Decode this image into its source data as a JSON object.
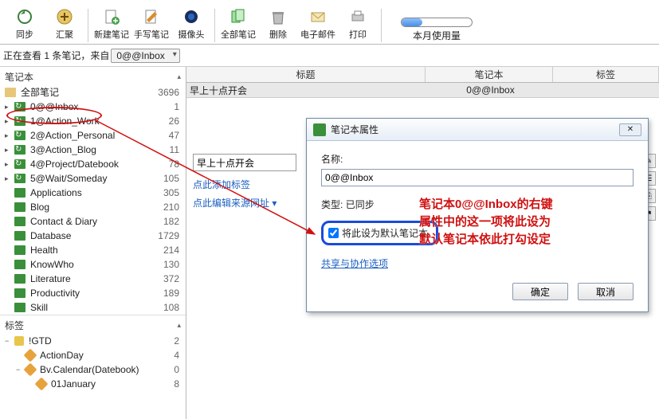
{
  "toolbar": {
    "sync": "同步",
    "aggregate": "汇聚",
    "new_note": "新建笔记",
    "handwrite": "手写笔记",
    "camera": "摄像头",
    "all_notes": "全部笔记",
    "delete": "删除",
    "email": "电子邮件",
    "print": "打印",
    "usage_label": "本月使用量"
  },
  "statusbar": {
    "prefix": "正在查看 1 条笔记，来自",
    "notebook": "0@@Inbox"
  },
  "sidebar": {
    "section_notebooks": "笔记本",
    "section_tags": "标签",
    "all_notes": {
      "label": "全部笔记",
      "count": "3696"
    },
    "notebooks": [
      {
        "label": "0@@Inbox",
        "count": "1",
        "highlighted": true
      },
      {
        "label": "1@Action_Work",
        "count": "26"
      },
      {
        "label": "2@Action_Personal",
        "count": "47"
      },
      {
        "label": "3@Action_Blog",
        "count": "11"
      },
      {
        "label": "4@Project/Datebook",
        "count": "78"
      },
      {
        "label": "5@Wait/Someday",
        "count": "105"
      },
      {
        "label": "Applications",
        "count": "305"
      },
      {
        "label": "Blog",
        "count": "210"
      },
      {
        "label": "Contact & Diary",
        "count": "182"
      },
      {
        "label": "Database",
        "count": "1729"
      },
      {
        "label": "Health",
        "count": "214"
      },
      {
        "label": "KnowWho",
        "count": "130"
      },
      {
        "label": "Literature",
        "count": "372"
      },
      {
        "label": "Productivity",
        "count": "189"
      },
      {
        "label": "Skill",
        "count": "108"
      }
    ],
    "tags": [
      {
        "label": "!GTD",
        "count": "2",
        "exp": "−",
        "indent": 0,
        "icon": "root"
      },
      {
        "label": "ActionDay",
        "count": "4",
        "exp": "",
        "indent": 1,
        "icon": "tag"
      },
      {
        "label": "Bv.Calendar(Datebook)",
        "count": "0",
        "exp": "−",
        "indent": 1,
        "icon": "tag"
      },
      {
        "label": "01January",
        "count": "8",
        "exp": "",
        "indent": 2,
        "icon": "tag"
      }
    ]
  },
  "list": {
    "headers": {
      "title": "标题",
      "notebook": "笔记本",
      "tags": "标签"
    },
    "row": {
      "title": "早上十点开会",
      "notebook": "0@@Inbox",
      "tags": ""
    }
  },
  "note": {
    "title_value": "早上十点开会",
    "add_tag": "点此添加标签",
    "edit_source": "点此编辑来源网址"
  },
  "dialog": {
    "title": "笔记本属性",
    "name_label": "名称:",
    "name_value": "0@@Inbox",
    "type_label": "类型:",
    "type_value": "已同步",
    "default_checkbox": "将此设为默认笔记本",
    "share_link": "共享与协作选项",
    "ok": "确定",
    "cancel": "取消"
  },
  "annotation": {
    "line1": "笔记本0@@Inbox的右键",
    "line2": "属性中的这一项将此设为",
    "line3": "默认笔记本依此打勾设定"
  }
}
